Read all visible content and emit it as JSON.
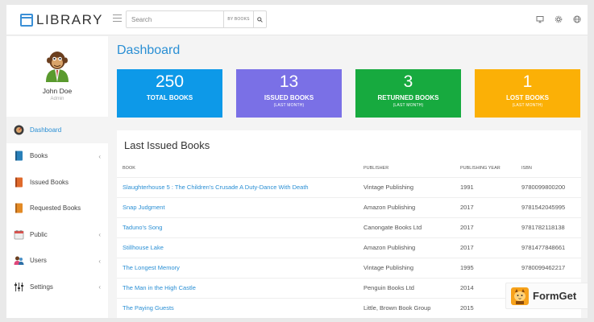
{
  "app": {
    "logo_text": "LIBRARY"
  },
  "search": {
    "placeholder": "Search",
    "filter_label": "BY BOOKS"
  },
  "user": {
    "name": "John Doe",
    "role": "Admin"
  },
  "sidebar": {
    "items": [
      {
        "label": "Dashboard",
        "icon": "dashboard-icon",
        "active": true,
        "caret": ""
      },
      {
        "label": "Books",
        "icon": "books-icon",
        "caret": "‹"
      },
      {
        "label": "Issued Books",
        "icon": "issued-books-icon",
        "caret": ""
      },
      {
        "label": "Requested Books",
        "icon": "requested-books-icon",
        "caret": ""
      },
      {
        "label": "Public",
        "icon": "calendar-icon",
        "caret": "‹"
      },
      {
        "label": "Users",
        "icon": "users-icon",
        "caret": "‹"
      },
      {
        "label": "Settings",
        "icon": "settings-sliders-icon",
        "caret": "‹"
      }
    ]
  },
  "main": {
    "title": "Dashboard",
    "stats": [
      {
        "value": "250",
        "label": "TOTAL BOOKS",
        "sublabel": "",
        "color": "#0d99e8"
      },
      {
        "value": "13",
        "label": "ISSUED BOOKS",
        "sublabel": "(LAST MONTH)",
        "color": "#7a70e6"
      },
      {
        "value": "3",
        "label": "RETURNED BOOKS",
        "sublabel": "(LAST MONTH)",
        "color": "#17aa3f"
      },
      {
        "value": "1",
        "label": "LOST BOOKS",
        "sublabel": "(LAST MONTH)",
        "color": "#fbb006"
      }
    ]
  },
  "table": {
    "title": "Last Issued Books",
    "headers": [
      "BOOK",
      "PUBLISHER",
      "PUBLISHING YEAR",
      "ISBN"
    ],
    "rows": [
      [
        "Slaughterhouse 5 : The Children's Crusade A Duty-Dance With Death",
        "Vintage Publishing",
        "1991",
        "9780099800200"
      ],
      [
        "Snap Judgment",
        "Amazon Publishing",
        "2017",
        "9781542045995"
      ],
      [
        "Taduno's Song",
        "Canongate Books Ltd",
        "2017",
        "9781782118138"
      ],
      [
        "Stillhouse Lake",
        "Amazon Publishing",
        "2017",
        "9781477848661"
      ],
      [
        "The Longest Memory",
        "Vintage Publishing",
        "1995",
        "9780099462217"
      ],
      [
        "The Man in the High Castle",
        "Penguin Books Ltd",
        "2014",
        ""
      ],
      [
        "The Paying Guests",
        "Little, Brown Book Group",
        "2015",
        ""
      ]
    ]
  },
  "watermark": {
    "text": "FormGet"
  },
  "colors": {
    "accent": "#2a8fd4"
  }
}
